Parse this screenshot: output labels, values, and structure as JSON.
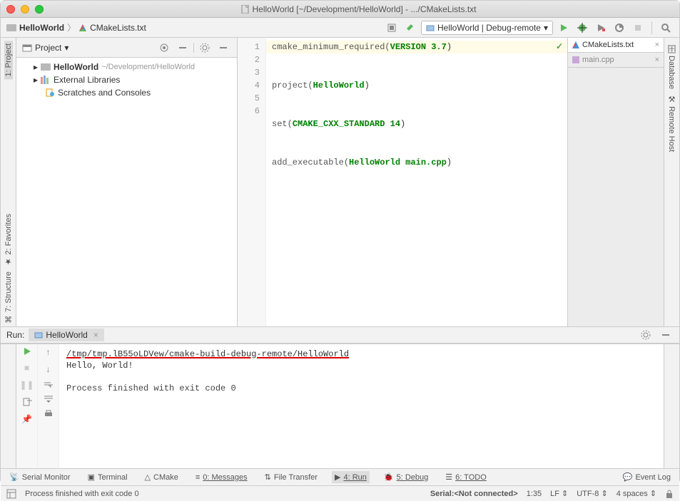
{
  "window": {
    "title": "HelloWorld [~/Development/HelloWorld] - .../CMakeLists.txt"
  },
  "breadcrumb": {
    "project": "HelloWorld",
    "file": "CMakeLists.txt"
  },
  "toolbar": {
    "run_config": "HelloWorld | Debug-remote"
  },
  "left_rail": {
    "project": "1: Project",
    "favorites": "2: Favorites",
    "structure": "7: Structure"
  },
  "right_rail": {
    "database": "Database",
    "remote_host": "Remote Host"
  },
  "project_panel": {
    "title": "Project",
    "tree": {
      "root_name": "HelloWorld",
      "root_path": "~/Development/HelloWorld",
      "external_libs": "External Libraries",
      "scratches": "Scratches and Consoles"
    }
  },
  "editor": {
    "line_numbers": [
      "1",
      "2",
      "3",
      "4",
      "5",
      "6"
    ],
    "lines": {
      "l1a": "cmake_minimum_required(",
      "l1b": "VERSION 3.7",
      "l1c": ")",
      "l2a": "project(",
      "l2b": "HelloWorld",
      "l2c": ")",
      "l4a": "set(",
      "l4b": "CMAKE_CXX_STANDARD 14",
      "l4c": ")",
      "l6a": "add_executable(",
      "l6b": "HelloWorld main.cpp",
      "l6c": ")"
    }
  },
  "file_tabs": {
    "tab1": "CMakeLists.txt",
    "tab2": "main.cpp"
  },
  "run_panel": {
    "label": "Run:",
    "tab_name": "HelloWorld",
    "output": {
      "path": "/tmp/tmp.lB55oLDVew/cmake-build-debug-remote/HelloWorld",
      "hello": "Hello, World!",
      "exit_msg": "Process finished with exit code 0"
    }
  },
  "bottom_tabs": {
    "serial_monitor": "Serial Monitor",
    "terminal": "Terminal",
    "cmake": "CMake",
    "messages": "0: Messages",
    "file_transfer": "File Transfer",
    "run": "4: Run",
    "debug": "5: Debug",
    "todo": "6: TODO",
    "event_log": "Event Log"
  },
  "status_bar": {
    "message": "Process finished with exit code 0",
    "serial": "Serial:<Not connected>",
    "pos": "1:35",
    "line_ending": "LF",
    "encoding": "UTF-8",
    "indent": "4 spaces"
  }
}
